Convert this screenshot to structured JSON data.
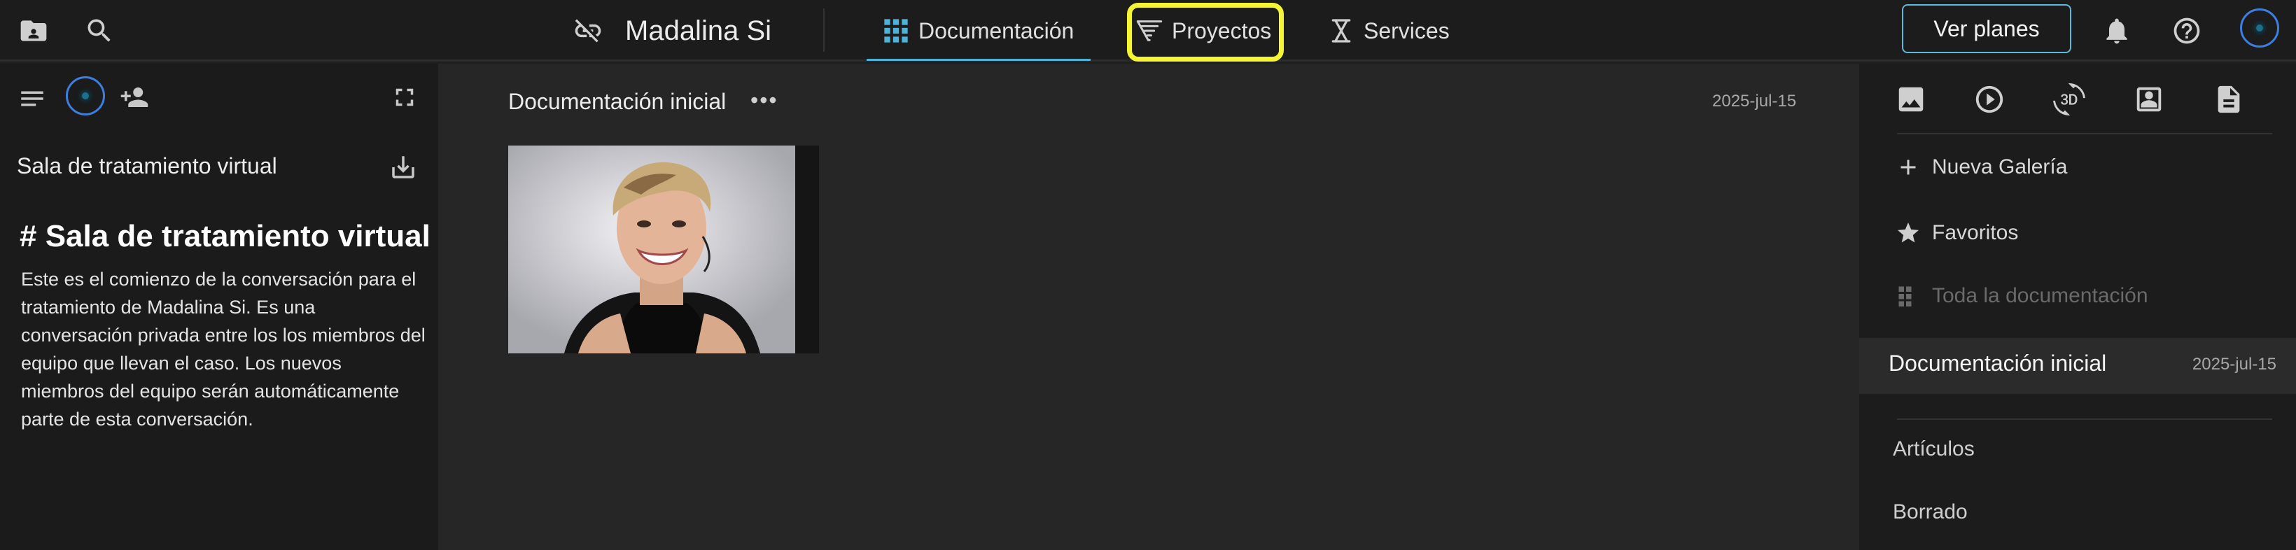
{
  "header": {
    "patient_name": "Madalina Si",
    "tabs": [
      {
        "label": "Documentación",
        "icon": "grid-icon",
        "active": true
      },
      {
        "label": "Proyectos",
        "icon": "filter-list-icon",
        "highlighted": true
      },
      {
        "label": "Services",
        "icon": "hourglass-icon"
      }
    ],
    "cta_label": "Ver planes",
    "icons": [
      "folder-person-icon",
      "search-icon",
      "unlink-icon",
      "bell-icon",
      "help-icon"
    ]
  },
  "left_panel": {
    "room_title": "Sala de tratamiento virtual",
    "heading": "# Sala de tratamiento virtual",
    "description": "Este es el comienzo de la conversación para el tratamiento de Madalina Si. Es una conversación privada entre los los miembros del equipo que llevan el caso. Los nuevos miembros del equipo serán automáticamente parte de esta conversación."
  },
  "main": {
    "gallery_title": "Documentación inicial",
    "more_label": "•••",
    "gallery_date": "2025-jul-15"
  },
  "right_panel": {
    "menu": [
      {
        "label": "Nueva Galería",
        "icon": "plus-icon"
      },
      {
        "label": "Favoritos",
        "icon": "star-icon"
      },
      {
        "label": "Toda la documentación",
        "icon": "grid-icon",
        "disabled": true
      }
    ],
    "active_gallery": {
      "label": "Documentación inicial",
      "date": "2025-jul-15"
    },
    "sections": [
      "Artículos",
      "Borrado"
    ],
    "filter_icons": [
      "image-icon",
      "play-icon",
      "3d-icon",
      "portrait-icon",
      "document-icon"
    ]
  },
  "colors": {
    "accent": "#4fb3d9",
    "highlight": "#f5f534",
    "background": "#1f1f1f"
  }
}
